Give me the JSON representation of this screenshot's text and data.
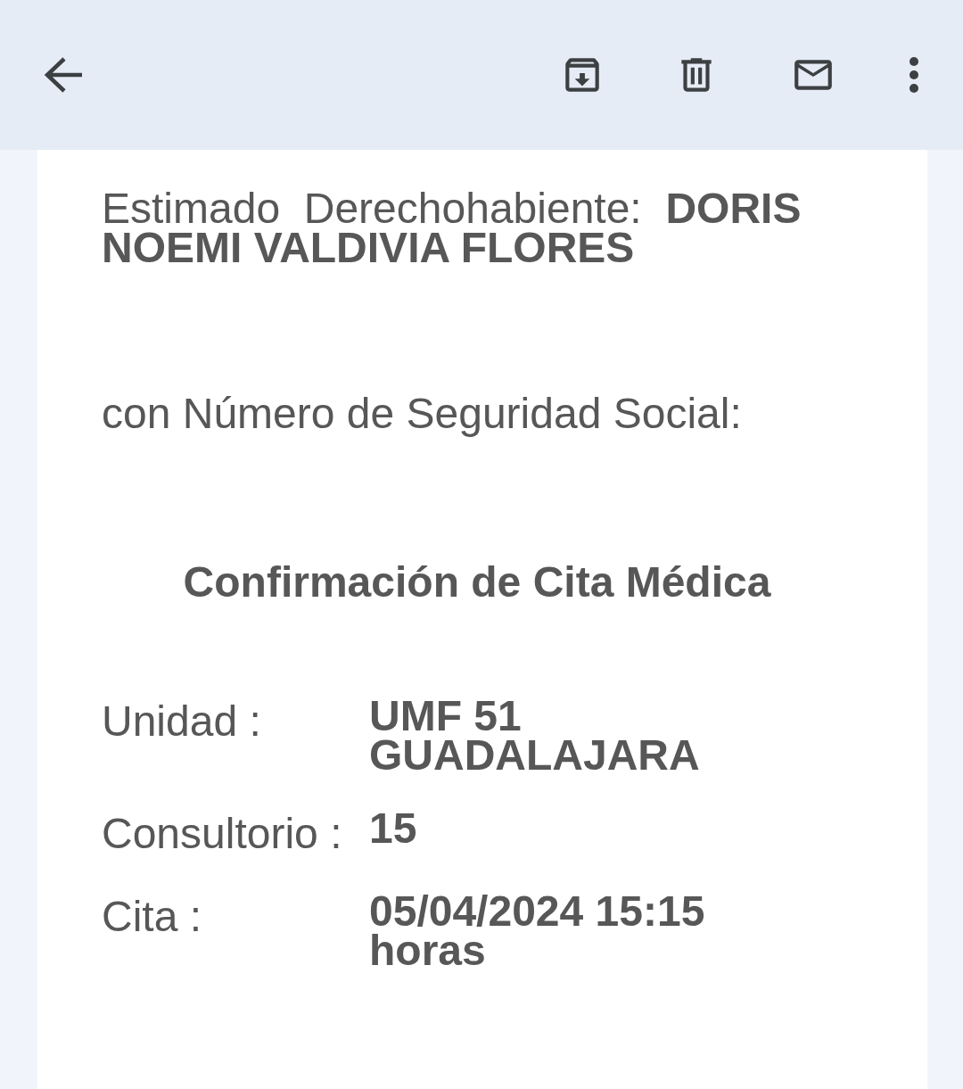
{
  "toolbar": {
    "actions": [
      {
        "kind": "archive"
      },
      {
        "kind": "delete"
      },
      {
        "kind": "mail"
      },
      {
        "kind": "more"
      }
    ]
  },
  "message": {
    "greeting": "Estimado  Derechohabiente:  **DORIS NOEMI VALDIVIA FLORES**",
    "ssn_label": "con Número de Seguridad Social:",
    "heading": "Confirmación de Cita Médica",
    "details": [
      {
        "label": "Unidad :",
        "value": "UMF 51 GUADALAJARA"
      },
      {
        "label": "Consultorio :",
        "value": "15"
      },
      {
        "label": "Cita :",
        "value": "05/04/2024 15:15 horas"
      }
    ]
  }
}
